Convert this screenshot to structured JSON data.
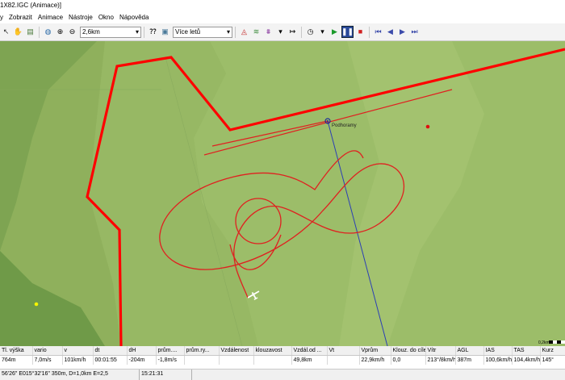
{
  "window": {
    "title": "1X82.IGC (Animace)]"
  },
  "menu": [
    "y",
    "Zobrazit",
    "Animace",
    "Nástroje",
    "Okno",
    "Nápověda"
  ],
  "toolbar": {
    "zoom_value": "2,6km",
    "flights_select": "Více letů"
  },
  "map": {
    "waypoint_label": "Podhoramy",
    "scale_label": "0,2km"
  },
  "table": {
    "headers": [
      "Tl. výška",
      "vario",
      "v",
      "dt",
      "dH",
      "prům....",
      "prům.ry...",
      "Vzdálenost",
      "klouzavost",
      "Vzdál.od ...",
      "Vt",
      "Vprům",
      "Klouz. do cíle",
      "Vítr",
      "AGL",
      "IAS",
      "TAS",
      "Kurz"
    ],
    "row": [
      "764m",
      "7,0m/s",
      "101km/h",
      "00:01:55",
      "-204m",
      "-1,8m/s",
      "",
      "",
      "",
      "49,8km",
      "",
      "22,9km/h",
      "0,0",
      "213°/8km/h",
      "387m",
      "100,6km/h",
      "104,4km/h",
      "145°"
    ]
  },
  "status": {
    "coords": "56'26\" E015°32'16\" 350m, D=1,0km E=2,5",
    "time": "15:21:31"
  },
  "colors": {
    "route": "#ff0000",
    "track": "#e02020",
    "bearing": "#2b3fb5",
    "map_bg": "#8fb05c"
  }
}
